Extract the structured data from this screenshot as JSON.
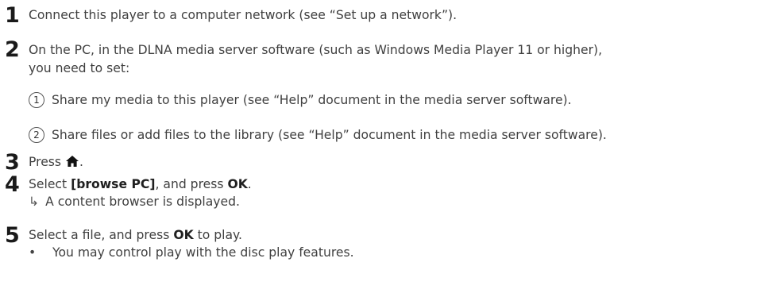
{
  "steps": [
    {
      "num": "1",
      "text": "Connect this player to a computer network (see “Set up a network”)."
    },
    {
      "num": "2",
      "line1": "On the PC, in the DLNA media server software (such as Windows Media Player 11 or higher),",
      "line2": "you need to set:",
      "sub": [
        {
          "num": "1",
          "text": "Share my media to this player (see “Help” document in the media server software)."
        },
        {
          "num": "2",
          "text": "Share files or add files to the library (see “Help” document in the media server software)."
        }
      ]
    },
    {
      "num": "3",
      "pre": "Press",
      "icon": "home-icon",
      "post": "."
    },
    {
      "num": "4",
      "pre": "Select ",
      "bold1": "[browse PC]",
      "mid": ", and press ",
      "bold2": "OK",
      "post": ".",
      "result": "A content browser is displayed."
    },
    {
      "num": "5",
      "pre": "Select a file, and press ",
      "bold": "OK",
      "post": " to play.",
      "bullet": "You may control play with the disc play features."
    }
  ]
}
